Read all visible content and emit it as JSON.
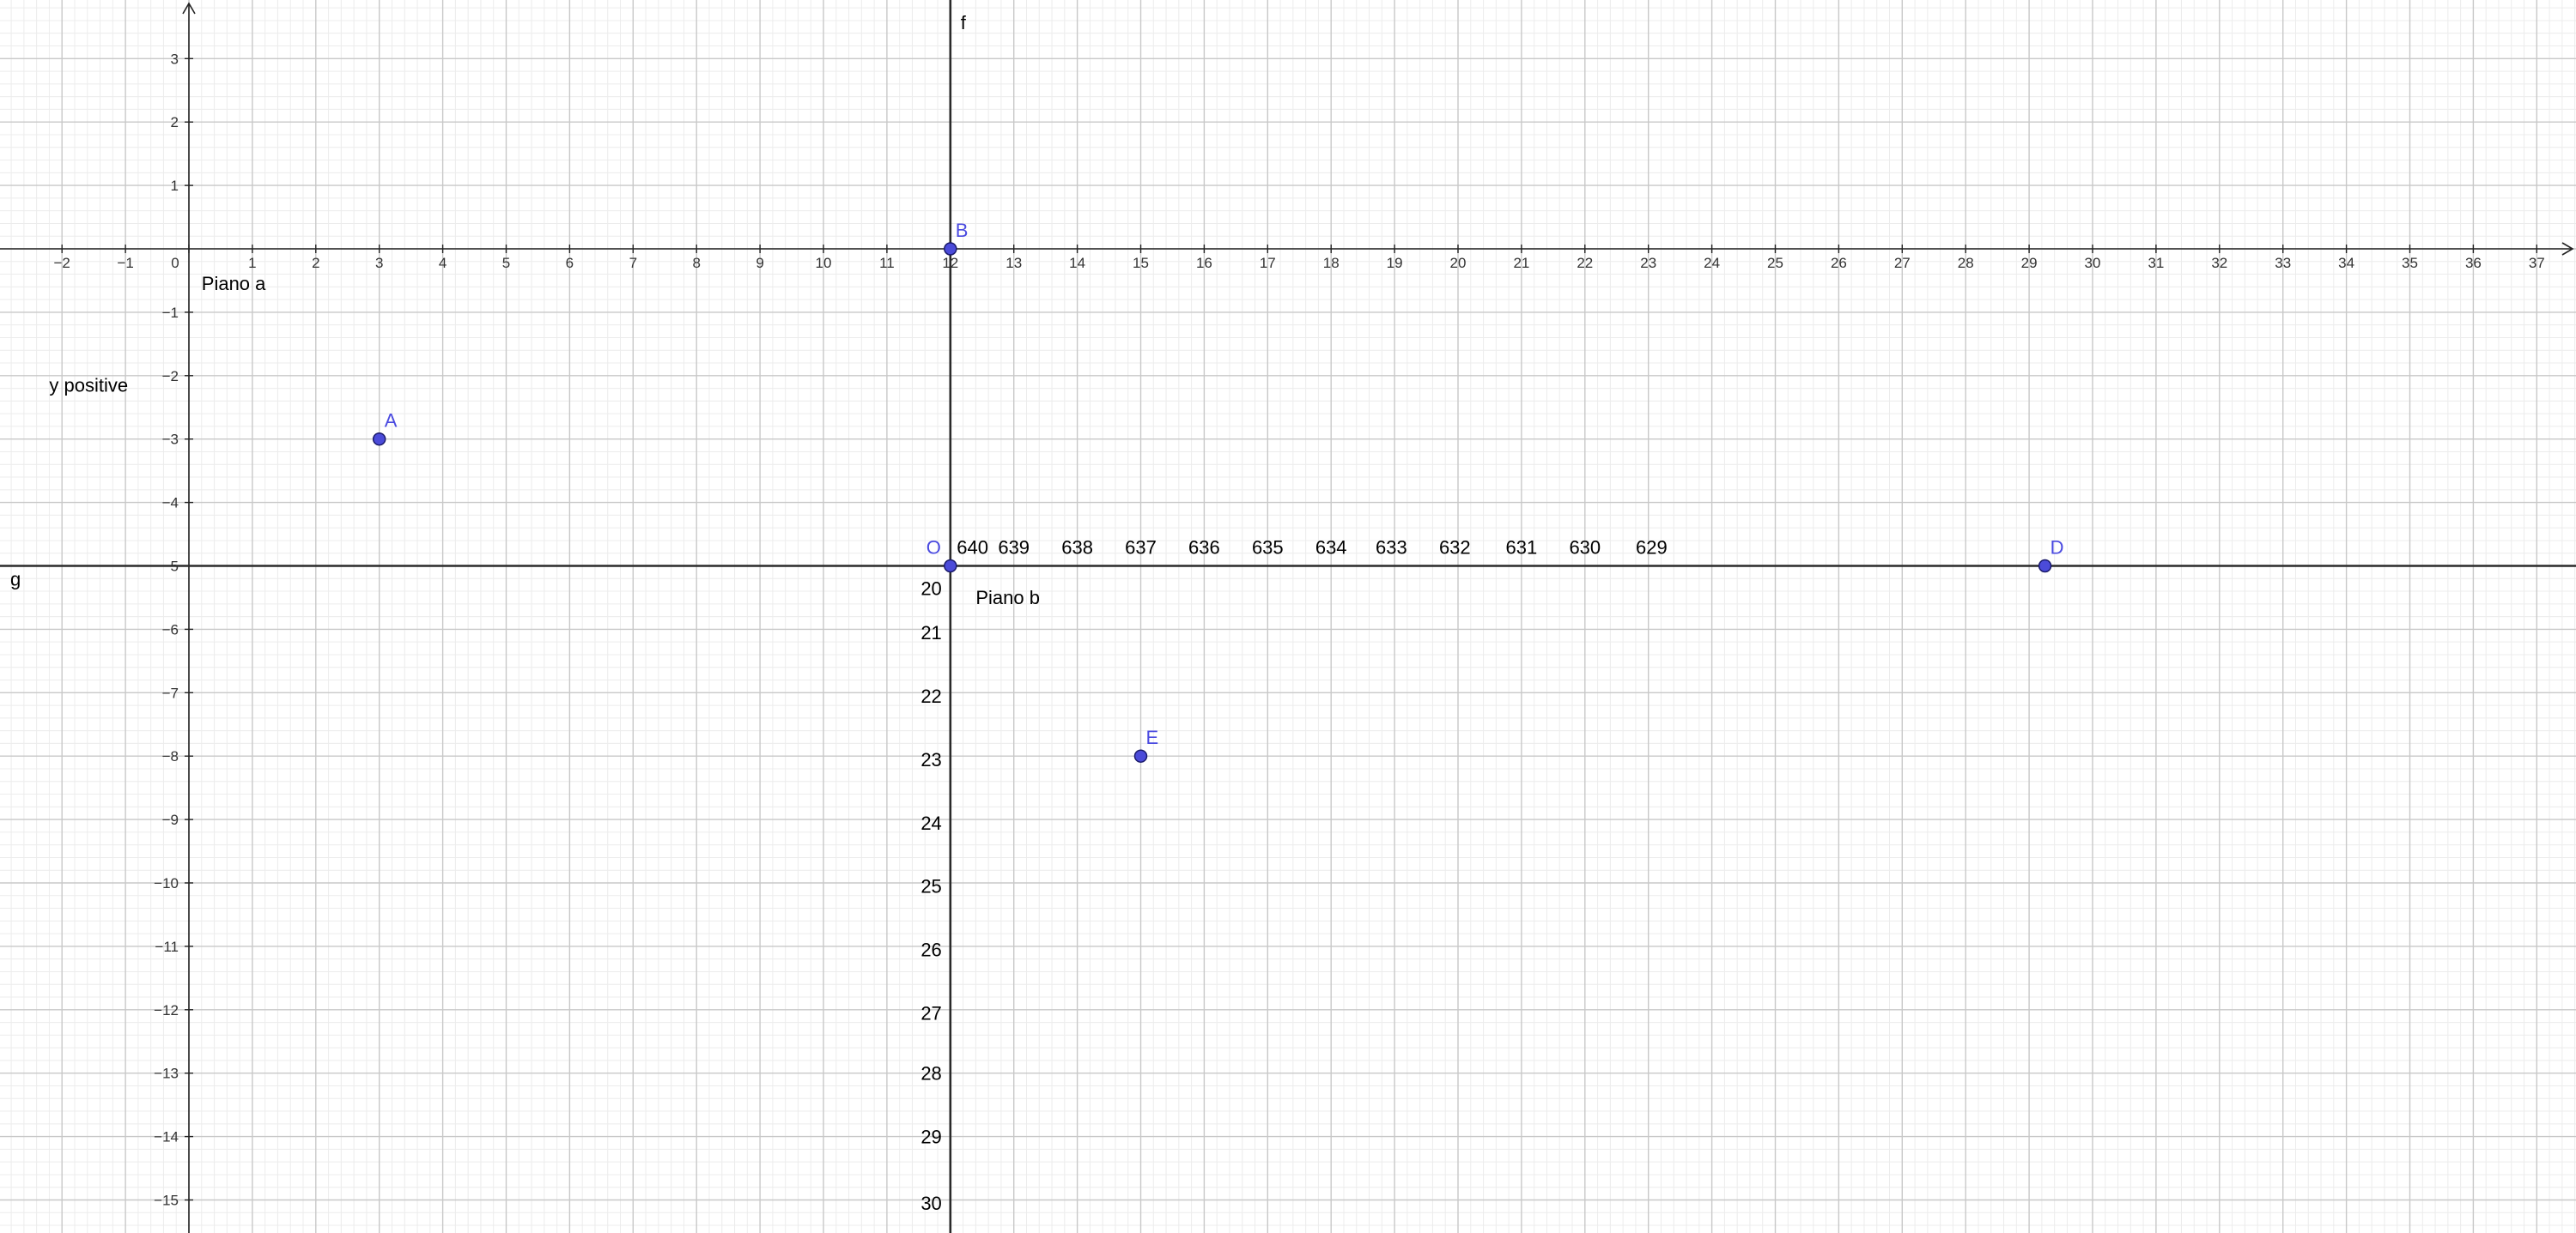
{
  "app": {
    "view": "graphics-view"
  },
  "axes": {
    "x_ticks": [
      -2,
      -1,
      0,
      1,
      2,
      3,
      4,
      5,
      6,
      7,
      8,
      9,
      10,
      11,
      12,
      13,
      14,
      15,
      16,
      17,
      18,
      19,
      20,
      21,
      22,
      23,
      24,
      25,
      26,
      27,
      28,
      29,
      30,
      31,
      32,
      33,
      34,
      35,
      36,
      37
    ],
    "y_ticks": [
      3,
      2,
      1,
      -1,
      -2,
      -3,
      -4,
      -5,
      -6,
      -7,
      -8,
      -9,
      -10,
      -11,
      -12,
      -13,
      -14,
      -15
    ],
    "x_range": [
      -3,
      38.6
    ],
    "y_range": [
      -15.5,
      3.9
    ],
    "grid": true
  },
  "lines": [
    {
      "name": "f",
      "type": "vertical",
      "x": 12
    },
    {
      "name": "g",
      "type": "horizontal",
      "y": -5
    }
  ],
  "points": [
    {
      "name": "A",
      "x": 3,
      "y": -3
    },
    {
      "name": "B",
      "x": 12,
      "y": 0
    },
    {
      "name": "O",
      "x": 12,
      "y": -5
    },
    {
      "name": "D",
      "x": 29.25,
      "y": -5
    },
    {
      "name": "E",
      "x": 15,
      "y": -8
    }
  ],
  "texts": [
    {
      "id": "piano-a",
      "text": "Piano a",
      "x": 0.2,
      "y": -0.65
    },
    {
      "id": "y-positive",
      "text": "y positive",
      "x": -2.2,
      "y": -2.25
    },
    {
      "id": "piano-b",
      "text": "Piano b",
      "x": 12.4,
      "y": -5.6
    }
  ],
  "secondary_x_labels": [
    {
      "text": "640",
      "x": 12.35
    },
    {
      "text": "639",
      "x": 13.0
    },
    {
      "text": "638",
      "x": 14.0
    },
    {
      "text": "637",
      "x": 15.0
    },
    {
      "text": "636",
      "x": 16.0
    },
    {
      "text": "635",
      "x": 17.0
    },
    {
      "text": "634",
      "x": 18.0
    },
    {
      "text": "633",
      "x": 18.95
    },
    {
      "text": "632",
      "x": 19.95
    },
    {
      "text": "631",
      "x": 21.0
    },
    {
      "text": "630",
      "x": 22.0
    },
    {
      "text": "629",
      "x": 23.05
    }
  ],
  "secondary_y_labels": [
    {
      "text": "20",
      "y": -5.35
    },
    {
      "text": "21",
      "y": -6.05
    },
    {
      "text": "22",
      "y": -7.05
    },
    {
      "text": "23",
      "y": -8.05
    },
    {
      "text": "24",
      "y": -9.05
    },
    {
      "text": "25",
      "y": -10.05
    },
    {
      "text": "26",
      "y": -11.05
    },
    {
      "text": "27",
      "y": -12.05
    },
    {
      "text": "28",
      "y": -13.0
    },
    {
      "text": "29",
      "y": -14.0
    },
    {
      "text": "30",
      "y": -15.05
    }
  ],
  "colors": {
    "grid_major": "#c8c8c8",
    "grid_minor": "#ececec",
    "axis": "#222222",
    "line": "#2a2a2a",
    "point_fill": "#4b4bd9",
    "point_label": "#4a4ae0"
  }
}
